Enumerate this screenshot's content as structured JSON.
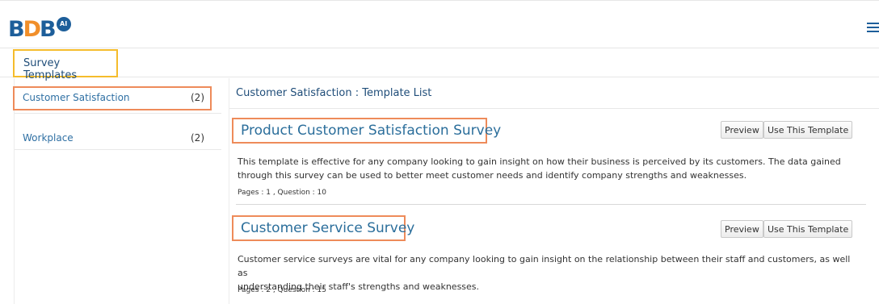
{
  "header": {
    "logo_text": "BDB",
    "logo_badge": "AI",
    "menu_icon": "hamburger-icon",
    "brand_blue": "#1d5e9a",
    "brand_orange": "#f18f2a"
  },
  "subnav": {
    "active_tab": "Survey Templates"
  },
  "sidebar": {
    "items": [
      {
        "label": "Customer Satisfaction",
        "count": "(2)"
      },
      {
        "label": "Workplace",
        "count": "(2)"
      }
    ]
  },
  "main": {
    "header": "Customer Satisfaction : Template List",
    "templates": [
      {
        "title": "Product Customer Satisfaction Survey",
        "description_line1": "This template is effective for any company looking to gain insight on how their business is perceived by its customers. The data gained",
        "description_line2": "through this survey can be used to better meet customer needs and identify company strengths and weaknesses.",
        "meta": "Pages : 1   ,   Question : 10",
        "preview_label": "Preview",
        "use_label": "Use This Template"
      },
      {
        "title": "Customer Service Survey",
        "description_line1": "Customer service surveys are vital for any company looking to gain insight on the relationship between their staff and customers, as well as",
        "description_line2": "understanding their staff's strengths and weaknesses.",
        "meta": "Pages : 2   ,   Question : 15",
        "preview_label": "Preview",
        "use_label": "Use This Template"
      }
    ]
  }
}
